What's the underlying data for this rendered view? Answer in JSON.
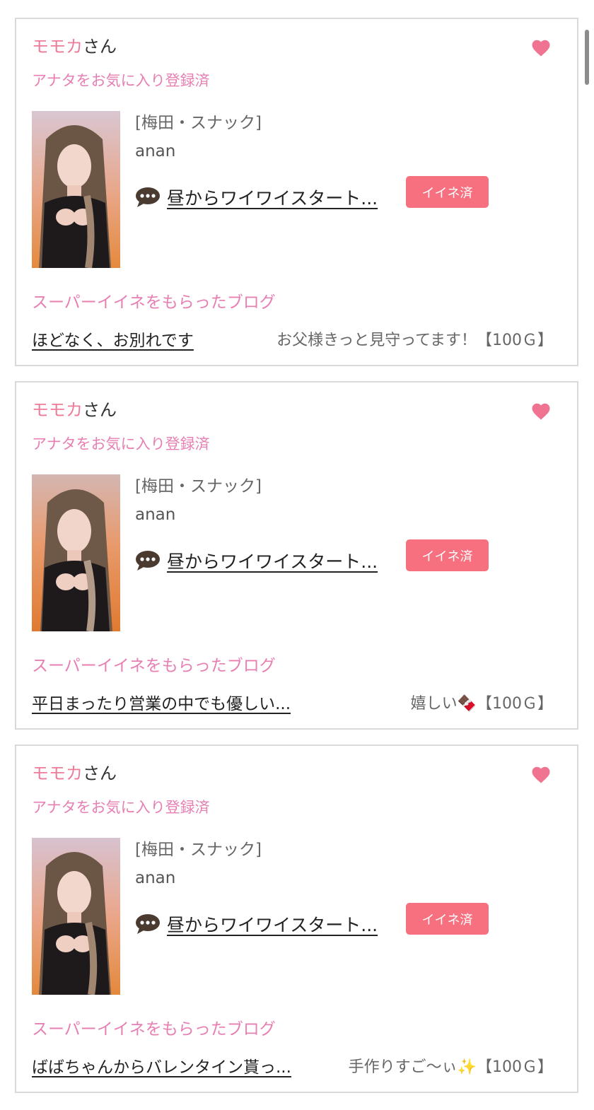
{
  "colors": {
    "accent_pink": "#ee7b97",
    "label_pink": "#e77fb3",
    "button_pink": "#f6707f",
    "border": "#d9d9d9"
  },
  "cards": [
    {
      "user_name": "モモカ",
      "user_suffix": "さん",
      "favorite_label": "アナタをお気に入り登録済",
      "heart_icon": "heart-icon",
      "area": "[梅田・スナック]",
      "shop": "anan",
      "message_icon": "speech-bubble-icon",
      "message": "昼からワイワイスタート...",
      "iine_button": "イイネ済",
      "super_label": "スーパーイイネをもらったブログ",
      "blog_title": "ほどなく、お別れです",
      "gift_text": "お父様きっと見守ってます！【100Ｇ】"
    },
    {
      "user_name": "モモカ",
      "user_suffix": "さん",
      "favorite_label": "アナタをお気に入り登録済",
      "heart_icon": "heart-icon",
      "area": "[梅田・スナック]",
      "shop": "anan",
      "message_icon": "speech-bubble-icon",
      "message": "昼からワイワイスタート...",
      "iine_button": "イイネ済",
      "super_label": "スーパーイイネをもらったブログ",
      "blog_title": "平日まったり営業の中でも優しい...",
      "gift_text": "嬉しい🍫【100Ｇ】"
    },
    {
      "user_name": "モモカ",
      "user_suffix": "さん",
      "favorite_label": "アナタをお気に入り登録済",
      "heart_icon": "heart-icon",
      "area": "[梅田・スナック]",
      "shop": "anan",
      "message_icon": "speech-bubble-icon",
      "message": "昼からワイワイスタート...",
      "iine_button": "イイネ済",
      "super_label": "スーパーイイネをもらったブログ",
      "blog_title": "ばばちゃんからバレンタイン貰っ...",
      "gift_text": "手作りすご〜ぃ✨【100Ｇ】"
    }
  ]
}
